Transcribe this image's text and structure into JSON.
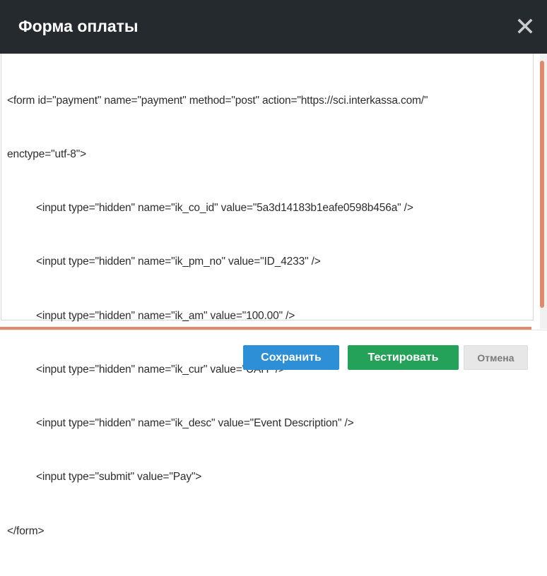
{
  "dialog": {
    "title": "Форма оплаты",
    "close_icon": "close-icon"
  },
  "editor": {
    "lines": [
      "<form id=\"payment\" name=\"payment\" method=\"post\" action=\"https://sci.interkassa.com/\"",
      "enctype=\"utf-8\">",
      "<input type=\"hidden\" name=\"ik_co_id\" value=\"5a3d14183b1eafe0598b456a\" />",
      "<input type=\"hidden\" name=\"ik_pm_no\" value=\"ID_4233\" />",
      "<input type=\"hidden\" name=\"ik_am\" value=\"100.00\" />",
      "<input type=\"hidden\" name=\"ik_cur\" value=\"UAH\" />",
      "<input type=\"hidden\" name=\"ik_desc\" value=\"Event Description\" />",
      "<input type=\"submit\" value=\"Pay\">",
      "</form>"
    ]
  },
  "buttons": {
    "save": "Сохранить",
    "test": "Тестировать",
    "cancel": "Отмена"
  },
  "colors": {
    "header_bg": "#252a2e",
    "save": "#2d8fd5",
    "test": "#25a25a",
    "cancel": "#e7e7e7",
    "accent_bar": "#e08a6b"
  }
}
